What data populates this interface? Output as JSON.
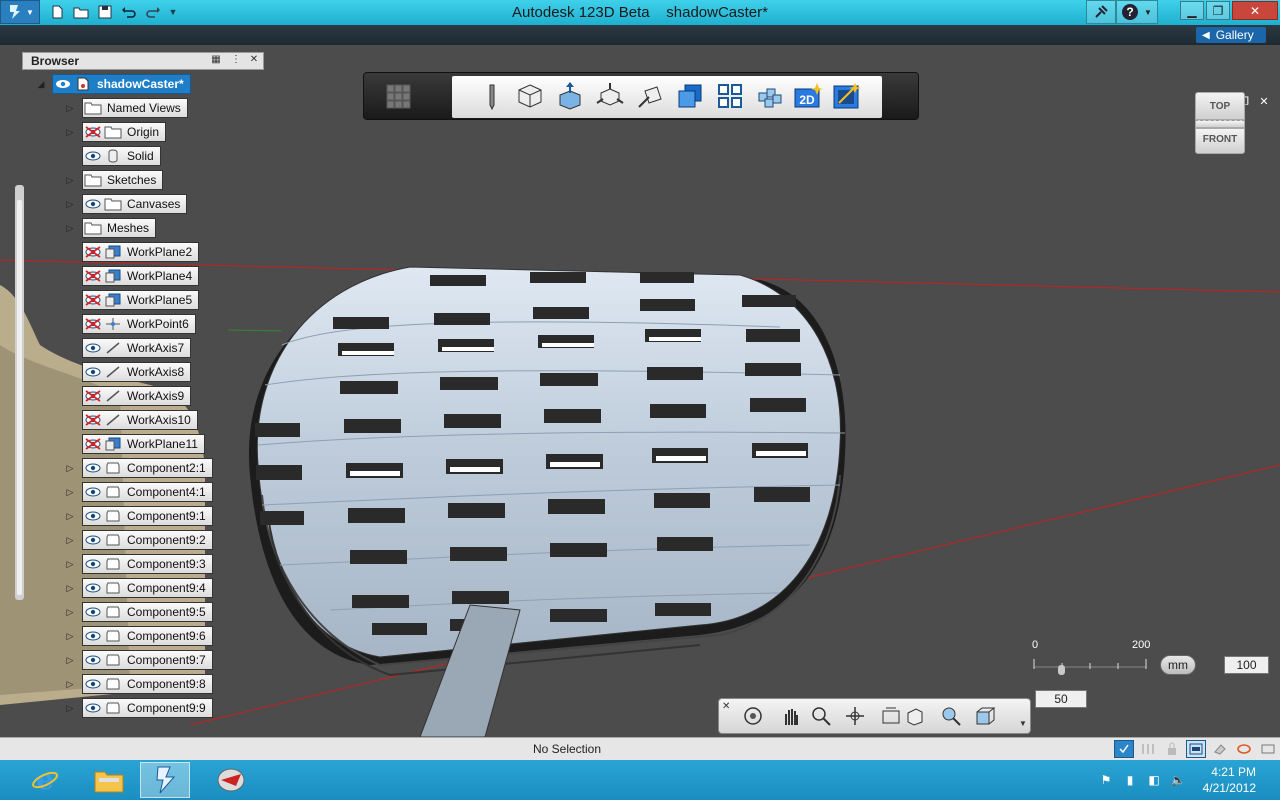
{
  "window": {
    "app_title": "Autodesk 123D Beta",
    "document_title": "shadowCaster*"
  },
  "gallery": {
    "label": "Gallery"
  },
  "browser": {
    "title": "Browser",
    "root": "shadowCaster*",
    "items": [
      {
        "label": "Named Views",
        "icon": "folder-icon",
        "visibility": "none",
        "expandable": true
      },
      {
        "label": "Origin",
        "icon": "folder-icon",
        "visibility": "hidden",
        "expandable": true
      },
      {
        "label": "Solid",
        "icon": "solid-icon",
        "visibility": "visible",
        "expandable": false
      },
      {
        "label": "Sketches",
        "icon": "folder-icon",
        "visibility": "none",
        "expandable": true
      },
      {
        "label": "Canvases",
        "icon": "folder-icon",
        "visibility": "visible",
        "expandable": true
      },
      {
        "label": "Meshes",
        "icon": "folder-icon",
        "visibility": "none",
        "expandable": true
      },
      {
        "label": "WorkPlane2",
        "icon": "workplane-icon",
        "visibility": "hidden",
        "expandable": false
      },
      {
        "label": "WorkPlane4",
        "icon": "workplane-icon",
        "visibility": "hidden",
        "expandable": false
      },
      {
        "label": "WorkPlane5",
        "icon": "workplane-icon",
        "visibility": "hidden",
        "expandable": false
      },
      {
        "label": "WorkPoint6",
        "icon": "workpoint-icon",
        "visibility": "hidden",
        "expandable": false
      },
      {
        "label": "WorkAxis7",
        "icon": "workaxis-icon",
        "visibility": "visible",
        "expandable": false
      },
      {
        "label": "WorkAxis8",
        "icon": "workaxis-icon",
        "visibility": "visible",
        "expandable": false
      },
      {
        "label": "WorkAxis9",
        "icon": "workaxis-icon",
        "visibility": "hidden",
        "expandable": false
      },
      {
        "label": "WorkAxis10",
        "icon": "workaxis-icon",
        "visibility": "hidden",
        "expandable": false
      },
      {
        "label": "WorkPlane11",
        "icon": "workplane-icon",
        "visibility": "hidden",
        "expandable": false
      },
      {
        "label": "Component2:1",
        "icon": "component-icon",
        "visibility": "visible",
        "expandable": true
      },
      {
        "label": "Component4:1",
        "icon": "component-icon",
        "visibility": "visible",
        "expandable": true
      },
      {
        "label": "Component9:1",
        "icon": "component-icon",
        "visibility": "visible",
        "expandable": true
      },
      {
        "label": "Component9:2",
        "icon": "component-icon",
        "visibility": "visible",
        "expandable": true
      },
      {
        "label": "Component9:3",
        "icon": "component-icon",
        "visibility": "visible",
        "expandable": true
      },
      {
        "label": "Component9:4",
        "icon": "component-icon",
        "visibility": "visible",
        "expandable": true
      },
      {
        "label": "Component9:5",
        "icon": "component-icon",
        "visibility": "visible",
        "expandable": true
      },
      {
        "label": "Component9:6",
        "icon": "component-icon",
        "visibility": "visible",
        "expandable": true
      },
      {
        "label": "Component9:7",
        "icon": "component-icon",
        "visibility": "visible",
        "expandable": true
      },
      {
        "label": "Component9:8",
        "icon": "component-icon",
        "visibility": "visible",
        "expandable": true
      },
      {
        "label": "Component9:9",
        "icon": "component-icon",
        "visibility": "visible",
        "expandable": true
      }
    ]
  },
  "toolbar": {
    "tools": [
      "3d-primitives-icon",
      "sketch-icon",
      "construct-icon",
      "modify-icon",
      "pattern-icon",
      "grouping-icon",
      "combine-icon",
      "measure-icon",
      "text-icon",
      "make-2d-icon",
      "smart-icon"
    ],
    "make2d_label": "2D"
  },
  "viewcube": {
    "top": "TOP",
    "front": "FRONT"
  },
  "scale": {
    "tick_start": "0",
    "tick_end": "200",
    "unit": "mm",
    "value": "100",
    "slider_value": "50"
  },
  "navbar": {
    "tools": [
      "orbit-icon",
      "pan-icon",
      "zoom-icon",
      "look-at-icon",
      "fit-icon",
      "view-icon",
      "visual-style-icon",
      "material-icon"
    ]
  },
  "status": {
    "text": "No Selection"
  },
  "taskbar": {
    "clock_time": "4:21 PM",
    "clock_date": "4/21/2012",
    "apps": [
      "internet-explorer-icon",
      "file-explorer-icon",
      "autodesk-123d-icon",
      "app-icon"
    ]
  },
  "colors": {
    "viewport_bg": "#4c4c4c",
    "titlebar": "#2fc0de",
    "taskbar": "#1f98c8",
    "root_node": "#1e7ec8",
    "model_fill": "#c8d6e4",
    "grid_line": "#c8201e"
  }
}
